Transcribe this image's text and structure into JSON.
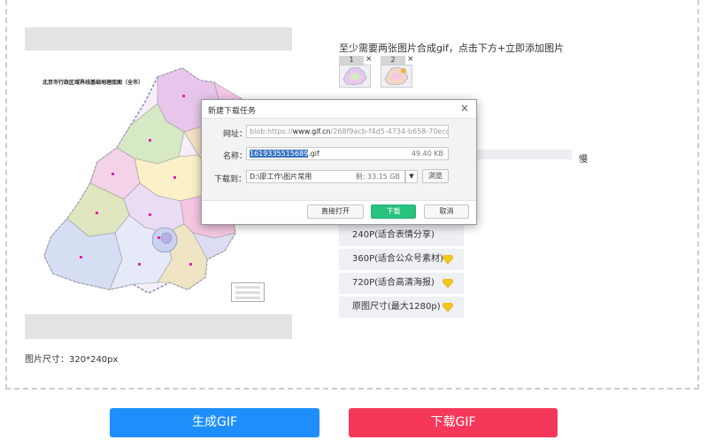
{
  "preview": {
    "map_title": "北京市行政区域界线基础地理底图（全市）",
    "size_label": "图片尺寸：320*240px"
  },
  "frames": {
    "hint": "至少需要两张图片合成gif，点击下方+立即添加图片",
    "thumbs": [
      {
        "num": "1",
        "close": "×"
      },
      {
        "num": "2",
        "close": "×"
      }
    ],
    "speed_label": "慢"
  },
  "size_options": [
    {
      "label": "240P(适合表情分享)",
      "premium": false
    },
    {
      "label": "360P(适合公众号素材)",
      "premium": true
    },
    {
      "label": "720P(适合高清海报)",
      "premium": true
    },
    {
      "label": "原图尺寸(最大1280p)",
      "premium": true
    }
  ],
  "actions": {
    "generate": "生成GIF",
    "download": "下载GIF"
  },
  "dialog": {
    "title": "新建下载任务",
    "close": "×",
    "url_label": "网址：",
    "url_prefix": "blob:https://",
    "url_host": "www.gif.cn",
    "url_suffix": "/268f9acb-f4d5-4734-b658-70ecd7f",
    "name_label": "名称：",
    "name_selected": "1619335515689",
    "name_ext": ".gif",
    "file_size": "49.40 KB",
    "save_label": "下载到：",
    "save_path": "D:\\廖工作\\图片常用",
    "free_space": "剩: 33.15 GB",
    "dropdown": "▼",
    "browse": "浏览",
    "open_direct": "直接打开",
    "download": "下载",
    "cancel": "取消"
  }
}
